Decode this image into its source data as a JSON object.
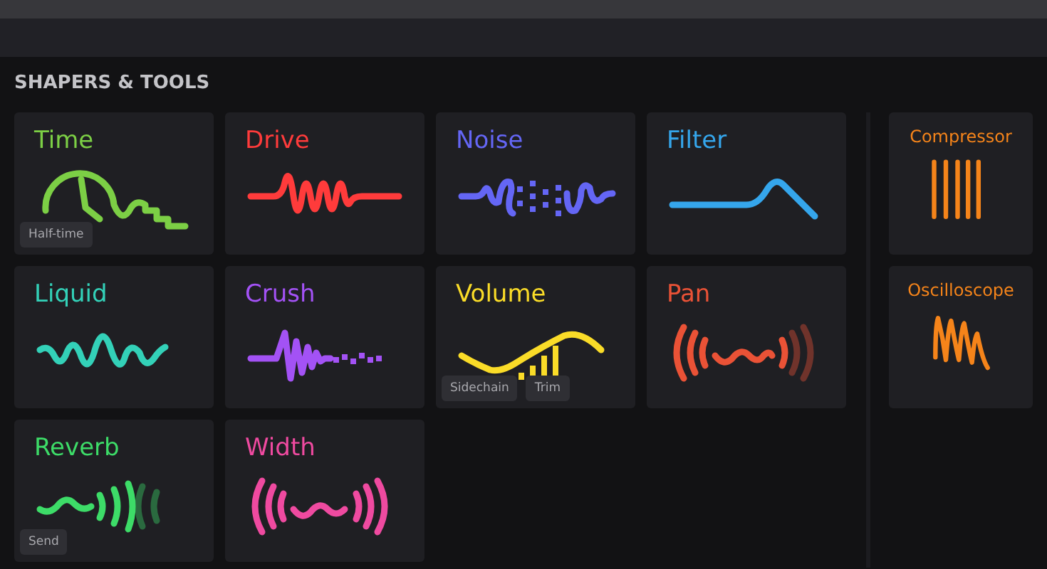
{
  "section_title": "SHAPERS & TOOLS",
  "shapers": [
    {
      "name": "Time",
      "color": "#7ccf45",
      "kind": "time",
      "tags": [
        "Half-time"
      ]
    },
    {
      "name": "Drive",
      "color": "#ff3b3b",
      "kind": "drive"
    },
    {
      "name": "Noise",
      "color": "#6466f5",
      "kind": "noise"
    },
    {
      "name": "Filter",
      "color": "#35a6ec",
      "kind": "filter"
    },
    {
      "name": "Liquid",
      "color": "#33d1b8",
      "kind": "liquid"
    },
    {
      "name": "Crush",
      "color": "#a352f5",
      "kind": "crush"
    },
    {
      "name": "Volume",
      "color": "#fadc28",
      "kind": "volume",
      "tags": [
        "Sidechain",
        "Trim"
      ]
    },
    {
      "name": "Pan",
      "color": "#ea5236",
      "kind": "pan"
    },
    {
      "name": "Reverb",
      "color": "#3ddc68",
      "kind": "reverb",
      "tags": [
        "Send"
      ]
    },
    {
      "name": "Width",
      "color": "#ef4aa0",
      "kind": "width"
    }
  ],
  "tools": [
    {
      "name": "Compressor",
      "color": "#f5841a",
      "kind": "compressor"
    },
    {
      "name": "Oscilloscope",
      "color": "#f5841a",
      "kind": "oscilloscope"
    }
  ]
}
